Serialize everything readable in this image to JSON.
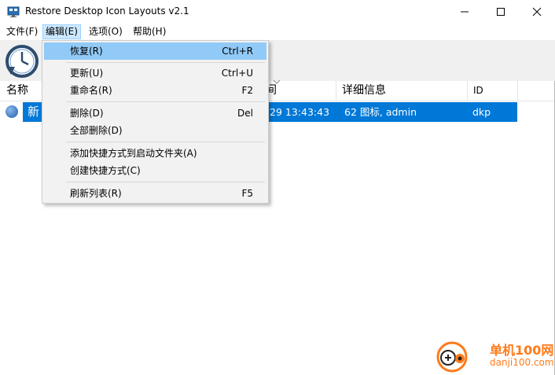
{
  "window": {
    "title": "Restore Desktop Icon Layouts v2.1"
  },
  "menubar": {
    "file": "文件(F)",
    "edit": "编辑(E)",
    "options": "选项(O)",
    "help": "帮助(H)"
  },
  "columns": {
    "name": "名称",
    "time_fragment": "间",
    "details": "详细信息",
    "id": "ID"
  },
  "rows": [
    {
      "name_fragment": "新",
      "time_fragment": "29 13:43:43",
      "details": "62 图标, admin",
      "id": "dkp",
      "selected": true
    }
  ],
  "edit_menu": {
    "items": [
      {
        "label": "恢复(R)",
        "shortcut": "Ctrl+R",
        "highlighted": true
      },
      {
        "label": "更新(U)",
        "shortcut": "Ctrl+U"
      },
      {
        "label": "重命名(R)",
        "shortcut": "F2"
      },
      {
        "label": "删除(D)",
        "shortcut": "Del"
      },
      {
        "label": "全部删除(D)",
        "shortcut": ""
      },
      {
        "label": "添加快捷方式到启动文件夹(A)",
        "shortcut": ""
      },
      {
        "label": "创建快捷方式(C)",
        "shortcut": ""
      },
      {
        "label": "刷新列表(R)",
        "shortcut": "F5"
      }
    ]
  },
  "watermark": {
    "line1": "单机100网",
    "line2": "danji100.com"
  },
  "colors": {
    "selection": "#0078d7",
    "menu_highlight": "#91c9f7",
    "menu_bg": "#f2f2f2",
    "toolbar_bg": "#f0f0f0",
    "watermark": "#ff7a1a"
  },
  "icons": {
    "app": "monitor-icon",
    "restore_tool": "clock-restore-icon",
    "row": "layout-globe-icon"
  }
}
